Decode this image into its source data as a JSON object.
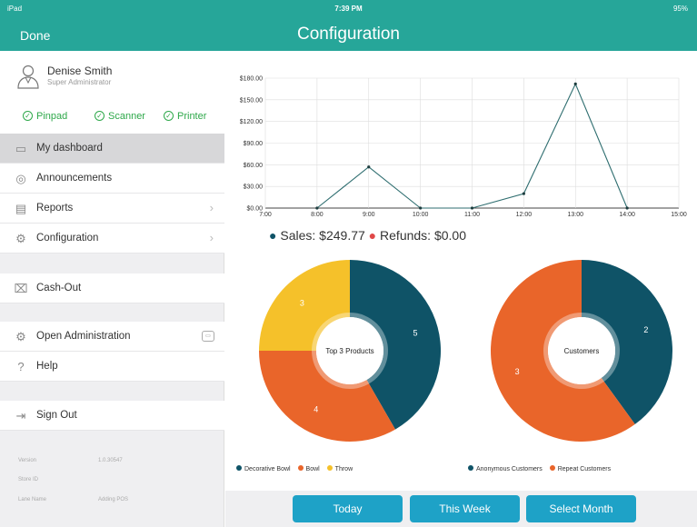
{
  "status": {
    "carrier": "iPad",
    "time": "7:39 PM",
    "battery": "95%"
  },
  "nav": {
    "done": "Done",
    "title": "Configuration"
  },
  "user": {
    "name": "Denise Smith",
    "role": "Super Administrator"
  },
  "devices": [
    "Pinpad",
    "Scanner",
    "Printer"
  ],
  "menu": {
    "dashboard": "My dashboard",
    "announcements": "Announcements",
    "reports": "Reports",
    "configuration": "Configuration",
    "cashout": "Cash-Out",
    "open_admin": "Open Administration",
    "help": "Help",
    "signout": "Sign Out"
  },
  "info": {
    "version_label": "Version",
    "version_value": "1.0.30547",
    "store_label": "Store ID",
    "store_value": "",
    "lane_label": "Lane Name",
    "lane_value": "Adding POS"
  },
  "summary": {
    "sales_label": "Sales:",
    "sales_value": "$249.77",
    "refunds_label": "Refunds:",
    "refunds_value": "$0.00"
  },
  "colors": {
    "teal": "#26a699",
    "navy": "#0f5367",
    "orange": "#e9652a",
    "yellow": "#f5c12a",
    "button": "#1ea2c7",
    "green": "#2ea84a",
    "red": "#e04848"
  },
  "buttons": {
    "today": "Today",
    "week": "This Week",
    "month": "Select Month"
  },
  "chart_data": [
    {
      "type": "line",
      "x": [
        "7:00",
        "8:00",
        "9:00",
        "10:00",
        "11:00",
        "12:00",
        "13:00",
        "14:00",
        "15:00"
      ],
      "y_ticks": [
        "$0.00",
        "$30.00",
        "$60.00",
        "$90.00",
        "$120.00",
        "$150.00",
        "$180.00"
      ],
      "ylim": [
        0,
        180
      ],
      "series": [
        {
          "name": "Sales",
          "values": [
            null,
            0,
            57,
            0,
            0,
            20,
            172,
            0,
            null
          ]
        }
      ]
    },
    {
      "type": "pie",
      "center_label": "Top 3 Products",
      "labels": [
        "Decorative Bowl",
        "Bowl",
        "Throw"
      ],
      "values": [
        5,
        4,
        3
      ],
      "colors": [
        "#0f5367",
        "#e9652a",
        "#f5c12a"
      ]
    },
    {
      "type": "pie",
      "center_label": "Customers",
      "labels": [
        "Anonymous Customers",
        "Repeat Customers"
      ],
      "values": [
        2,
        3
      ],
      "colors": [
        "#0f5367",
        "#e9652a"
      ]
    }
  ]
}
